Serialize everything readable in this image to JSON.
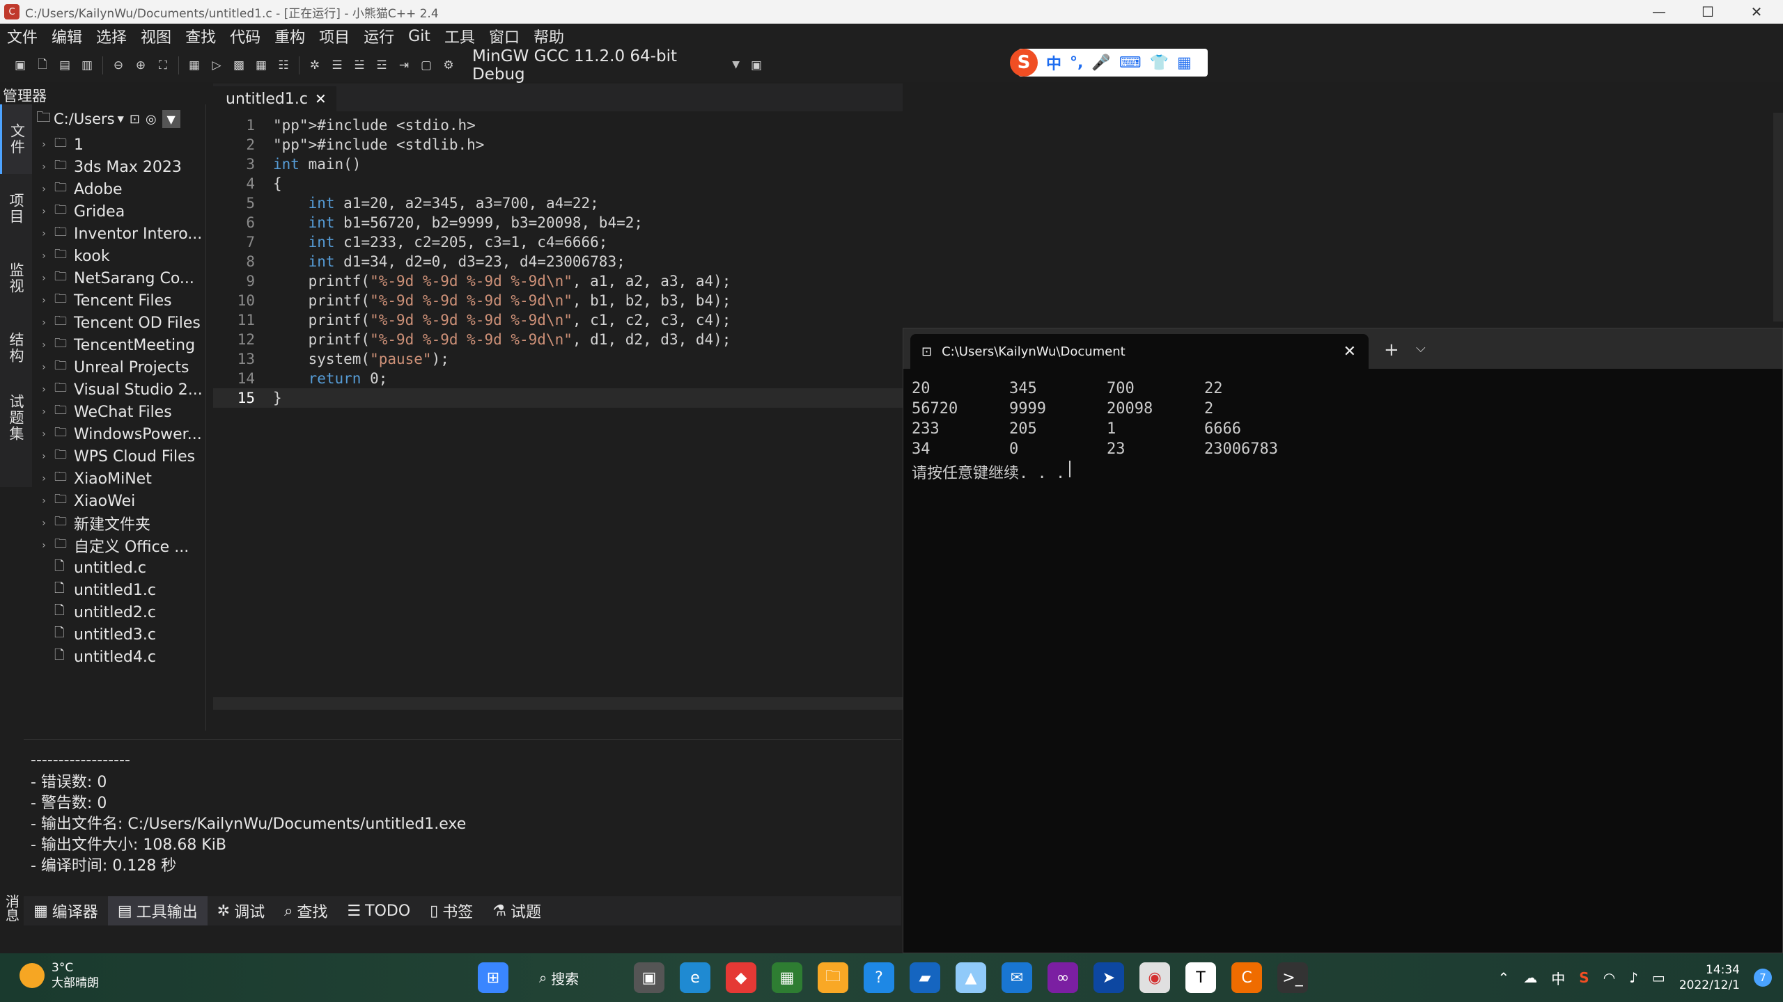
{
  "window": {
    "title": "C:/Users/KailynWu/Documents/untitled1.c - [正在运行] - 小熊猫C++ 2.4",
    "minimize": "—",
    "maximize": "☐",
    "close": "✕"
  },
  "menu": [
    "文件",
    "编辑",
    "选择",
    "视图",
    "查找",
    "代码",
    "重构",
    "项目",
    "运行",
    "Git",
    "工具",
    "窗口",
    "帮助"
  ],
  "toolbar": {
    "compiler": "MinGW GCC 11.2.0 64-bit Debug"
  },
  "ime": {
    "logo": "S",
    "items": [
      "中",
      "°,",
      "🎤",
      "⌨",
      "👕",
      "▦"
    ]
  },
  "manager": {
    "label": "管理器",
    "path": "C:/Users",
    "side_tabs": [
      "文件",
      "项目",
      "监视",
      "结构",
      "试题集"
    ],
    "tree": [
      {
        "name": "1",
        "type": "folder"
      },
      {
        "name": "3ds Max 2023",
        "type": "folder"
      },
      {
        "name": "Adobe",
        "type": "folder"
      },
      {
        "name": "Gridea",
        "type": "folder"
      },
      {
        "name": "Inventor Intero...",
        "type": "folder"
      },
      {
        "name": "kook",
        "type": "folder"
      },
      {
        "name": "NetSarang Co...",
        "type": "folder"
      },
      {
        "name": "Tencent Files",
        "type": "folder"
      },
      {
        "name": "Tencent OD Files",
        "type": "folder"
      },
      {
        "name": "TencentMeeting",
        "type": "folder"
      },
      {
        "name": "Unreal Projects",
        "type": "folder"
      },
      {
        "name": "Visual Studio 2...",
        "type": "folder"
      },
      {
        "name": "WeChat Files",
        "type": "folder"
      },
      {
        "name": "WindowsPower...",
        "type": "folder"
      },
      {
        "name": "WPS Cloud Files",
        "type": "folder"
      },
      {
        "name": "XiaoMiNet",
        "type": "folder"
      },
      {
        "name": "XiaoWei",
        "type": "folder"
      },
      {
        "name": "新建文件夹",
        "type": "folder"
      },
      {
        "name": "自定义 Office ...",
        "type": "folder"
      },
      {
        "name": "untitled.c",
        "type": "file"
      },
      {
        "name": "untitled1.c",
        "type": "file"
      },
      {
        "name": "untitled2.c",
        "type": "file"
      },
      {
        "name": "untitled3.c",
        "type": "file"
      },
      {
        "name": "untitled4.c",
        "type": "file"
      }
    ]
  },
  "editor": {
    "tab": "untitled1.c",
    "lines": [
      "#include <stdio.h>",
      "#include <stdlib.h>",
      "int main()",
      "{",
      "    int a1=20, a2=345, a3=700, a4=22;",
      "    int b1=56720, b2=9999, b3=20098, b4=2;",
      "    int c1=233, c2=205, c3=1, c4=6666;",
      "    int d1=34, d2=0, d3=23, d4=23006783;",
      "    printf(\"%-9d %-9d %-9d %-9d\\n\", a1, a2, a3, a4);",
      "    printf(\"%-9d %-9d %-9d %-9d\\n\", b1, b2, b3, b4);",
      "    printf(\"%-9d %-9d %-9d %-9d\\n\", c1, c2, c3, c4);",
      "    printf(\"%-9d %-9d %-9d %-9d\\n\", d1, d2, d3, d4);",
      "    system(\"pause\");",
      "    return 0;",
      "}"
    ],
    "current_line": 15
  },
  "output": {
    "lines": [
      "------------------",
      "- 错误数: 0",
      "- 警告数: 0",
      "- 输出文件名: C:/Users/KailynWu/Documents/untitled1.exe",
      "- 输出文件大小: 108.68 KiB",
      "- 编译时间: 0.128 秒"
    ]
  },
  "bottom_tabs": [
    {
      "icon": "▦",
      "label": "编译器",
      "active": false
    },
    {
      "icon": "▤",
      "label": "工具输出",
      "active": true
    },
    {
      "icon": "✲",
      "label": "调试",
      "active": false
    },
    {
      "icon": "⌕",
      "label": "查找",
      "active": false
    },
    {
      "icon": "☰",
      "label": "TODO",
      "active": false
    },
    {
      "icon": "▯",
      "label": "书签",
      "active": false
    },
    {
      "icon": "⚗",
      "label": "试题",
      "active": false
    }
  ],
  "message_tab": "消息",
  "terminal": {
    "tab_title": "C:\\Users\\KailynWu\\Document",
    "new_tab": "+",
    "dropdown": "⌵",
    "rows": [
      [
        "20",
        "345",
        "700",
        "22"
      ],
      [
        "56720",
        "9999",
        "20098",
        "2"
      ],
      [
        "233",
        "205",
        "1",
        "6666"
      ],
      [
        "34",
        "0",
        "23",
        "23006783"
      ]
    ],
    "prompt": "请按任意键继续. . ."
  },
  "taskbar": {
    "temperature": "3°C",
    "weather": "大部晴朗",
    "search": "搜索",
    "ime_indicator": "中",
    "time": "14:34",
    "date": "2022/12/1",
    "notifications": "7"
  }
}
